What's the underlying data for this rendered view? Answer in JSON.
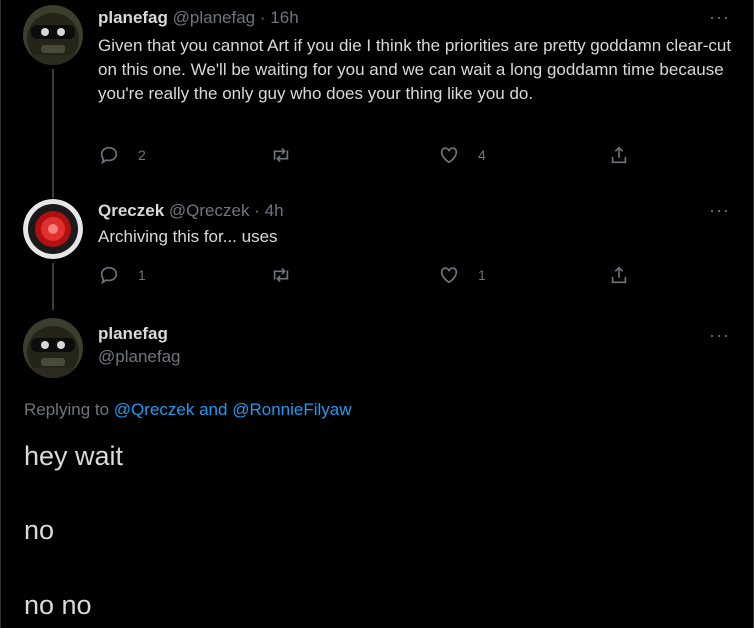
{
  "tweets": [
    {
      "name": "planefag",
      "handle": "@planefag",
      "dot": "·",
      "time": "16h",
      "text": "Given that you cannot Art if you die I think the priorities are pretty goddamn clear-cut on this one. We'll be waiting for you and we can wait a long goddamn time because you're really the only guy who does your thing like you do.",
      "reply_count": "2",
      "like_count": "4",
      "more": "···"
    },
    {
      "name": "Qreczek",
      "handle": "@Qreczek",
      "dot": "·",
      "time": "4h",
      "text": "Archiving this for... uses",
      "reply_count": "1",
      "like_count": "1",
      "more": "···"
    }
  ],
  "main_tweet": {
    "name": "planefag",
    "handle": "@planefag",
    "more": "···",
    "replying_prefix": "Replying to",
    "reply_user1": "@Qreczek",
    "reply_and": "and",
    "reply_user2": "@RonnieFilyaw",
    "lines": [
      "hey wait",
      "no",
      "no no"
    ]
  },
  "colors": {
    "background": "#000000",
    "text": "#d9d9d9",
    "secondary": "#6e767d",
    "link": "#1d9bf0"
  },
  "icons": [
    "reply-icon",
    "retweet-icon",
    "like-icon",
    "share-icon",
    "more-icon"
  ]
}
